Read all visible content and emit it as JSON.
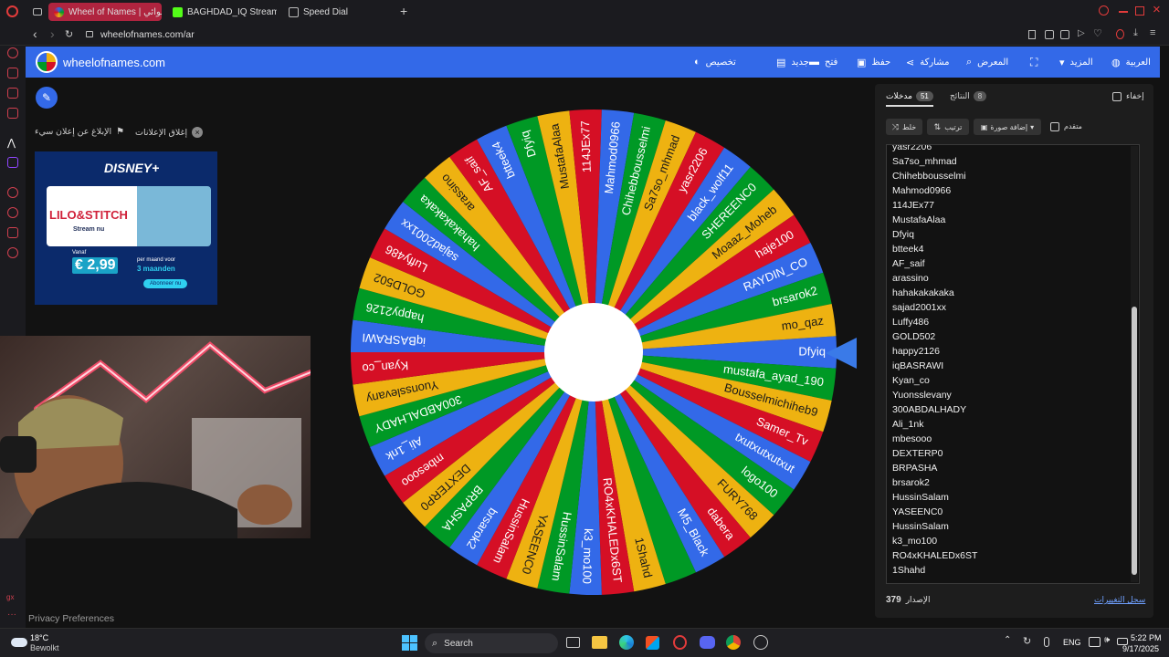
{
  "browser": {
    "tabs": [
      {
        "title": "Wheel of Names | عشوائي",
        "active": true,
        "color": "#e23b3b"
      },
      {
        "title": "BAGHDAD_IQ Stream - W",
        "active": false,
        "color": "#53fc18"
      },
      {
        "title": "Speed Dial",
        "active": false,
        "color": "#888888"
      }
    ],
    "url": "wheelofnames.com/ar"
  },
  "site": {
    "logo_text": "wheelofnames.com",
    "nav": {
      "customize": "تخصيص",
      "new": "جديد",
      "open": "فتح",
      "save": "حفظ",
      "share": "مشاركة",
      "gallery": "المعرض",
      "more": "المزيد",
      "language": "العربية"
    },
    "ads": {
      "close_ads": "إغلاق الإعلانات",
      "report_ad": "الإبلاغ عن إعلان سيء",
      "ad_brand": "DISNEY+",
      "ad_title": "LILO&STITCH",
      "ad_subtitle": "Stream nu",
      "ad_vanaf": "Vanaf",
      "ad_price": "€ 2,99",
      "ad_price_note": "per maand voor",
      "ad_period": "3 maanden",
      "ad_cta": "Abonneer nu"
    },
    "privacy": "Privacy Preferences"
  },
  "panel": {
    "hide_label": "إخفاء",
    "tab_results": "النتائج",
    "tab_results_count": "8",
    "tab_entries": "مدخلات",
    "tab_entries_count": "51",
    "shuffle": "خلط",
    "sort": "ترتيب",
    "add_image": "إضافة صورة",
    "advanced": "متقدم",
    "entries": [
      "yasr2206",
      "Sa7so_mhmad",
      "Chihebbousselmi",
      "Mahmod0966",
      "114JEx77",
      "MustafaAlaa",
      "Dfyiq",
      "btteek4",
      "AF_saif",
      "arassino",
      "hahakakakaka",
      "sajad2001xx",
      "Luffy486",
      "GOLD502",
      "happy2126",
      "iqBASRAWI",
      "Kyan_co",
      "Yuonsslevany",
      "300ABDALHADY",
      "Ali_1nk",
      "mbesooo",
      "DEXTERP0",
      "BRPASHA",
      "brsarok2",
      "HussinSalam",
      "YASEENC0",
      "HussinSalam",
      "k3_mo100",
      "RO4xKHALEDx6ST",
      "1Shahd"
    ],
    "version_label": "الإصدار",
    "version": "379",
    "changelog": "سجل التغييرات"
  },
  "wheel": {
    "segments": [
      "Dfyiq",
      "mustafa_ayad_190",
      "Bousselmichiheb9",
      "Samer_Tv",
      "txutxutxutxut",
      "logo100",
      "FURY768",
      "dabera",
      "M5_Black",
      "",
      "1Shahd",
      "RO4xKHALEDx6ST",
      "k3_mo100",
      "HussinSalam",
      "YASEENC0",
      "HussinSalam",
      "brsarok2",
      "BRPASHA",
      "DEXTERP0",
      "mbesooo",
      "Ali_1nk",
      "300ABDALHADY",
      "Yuonsslevany",
      "Kyan_co",
      "iqBASRAWI",
      "happy2126",
      "GOLD502",
      "Luffy486",
      "sajad2001xx",
      "hahakakakaka",
      "arassino",
      "AF_saif",
      "btteek4",
      "Dfyiq",
      "MustafaAlaa",
      "114JEx77",
      "Mahmod0966",
      "Chihebbousselmi",
      "Sa7so_mhmad",
      "yasr2206",
      "black_wolf11",
      "SHEREENC0",
      "Moaaz_Moheb",
      "haje100",
      "RAYDIN_CO",
      "brsarok2",
      "mo_qaz"
    ],
    "colors": [
      "#3369e8",
      "#009925",
      "#eeb211",
      "#d50f25"
    ]
  },
  "taskbar": {
    "weather_temp": "18°C",
    "weather_desc": "Bewolkt",
    "search": "Search",
    "lang": "ENG",
    "time": "5:22 PM",
    "date": "9/17/2025"
  }
}
